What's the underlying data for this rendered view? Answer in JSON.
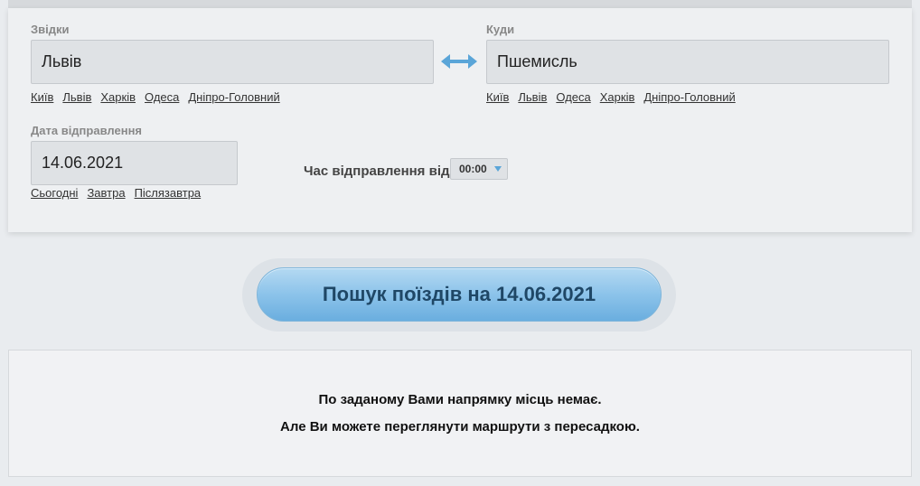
{
  "from": {
    "label": "Звідки",
    "value": "Львів",
    "quick_links": [
      "Київ",
      "Львів",
      "Харків",
      "Одеса",
      "Дніпро-Головний"
    ]
  },
  "to": {
    "label": "Куди",
    "value": "Пшемисль",
    "quick_links": [
      "Київ",
      "Львів",
      "Одеса",
      "Харків",
      "Дніпро-Головний"
    ]
  },
  "date": {
    "label": "Дата відправлення",
    "value": "14.06.2021",
    "quick_links": [
      "Сьогодні",
      "Завтра",
      "Післязавтра"
    ]
  },
  "time": {
    "label": "Час відправлення від",
    "value": "00:00"
  },
  "search": {
    "label": "Пошук поїздів на 14.06.2021"
  },
  "result": {
    "line1": "По заданому Вами напрямку місць немає.",
    "line2": "Але Ви можете переглянути маршрути з пересадкою."
  },
  "icons": {
    "swap": "swap-arrows-icon",
    "dropdown": "chevron-down-icon"
  },
  "colors": {
    "accent": "#6aaedf",
    "button_text": "#1f4766"
  }
}
